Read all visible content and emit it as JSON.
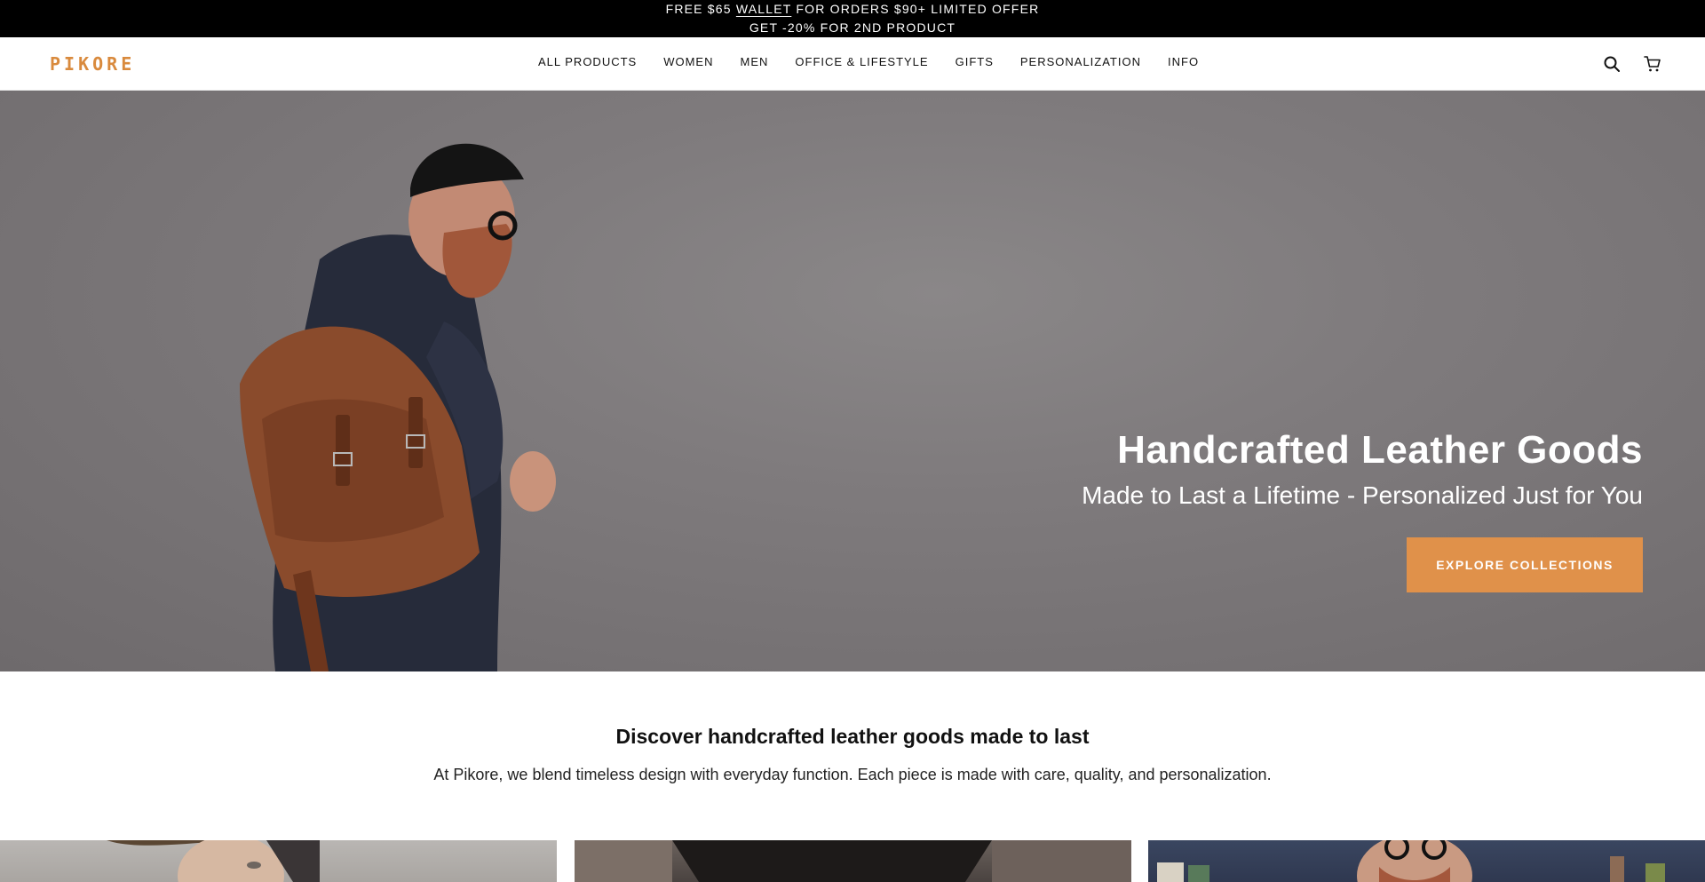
{
  "announcement": {
    "line1_pre": "FREE $65 ",
    "line1_link": "WALLET",
    "line1_post": " FOR ORDERS $90+ LIMITED OFFER",
    "line2": "GET -20% FOR 2ND PRODUCT"
  },
  "header": {
    "logo": "PIKORE",
    "nav": [
      {
        "label": "ALL PRODUCTS"
      },
      {
        "label": "WOMEN"
      },
      {
        "label": "MEN"
      },
      {
        "label": "OFFICE & LIFESTYLE"
      },
      {
        "label": "GIFTS"
      },
      {
        "label": "PERSONALIZATION"
      },
      {
        "label": "INFO"
      }
    ],
    "icons": {
      "search": "search-icon",
      "cart": "cart-icon"
    }
  },
  "hero": {
    "title": "Handcrafted Leather Goods",
    "subtitle": "Made to Last a Lifetime - Personalized Just for You",
    "button": "EXPLORE COLLECTIONS",
    "button_color": "#e0914a"
  },
  "intro": {
    "title": "Discover handcrafted leather goods made to last",
    "text": "At Pikore, we blend timeless design with everyday function. Each piece is made with care, quality, and personalization."
  },
  "colors": {
    "brand": "#d98a3d",
    "announce_bg": "#000000"
  }
}
